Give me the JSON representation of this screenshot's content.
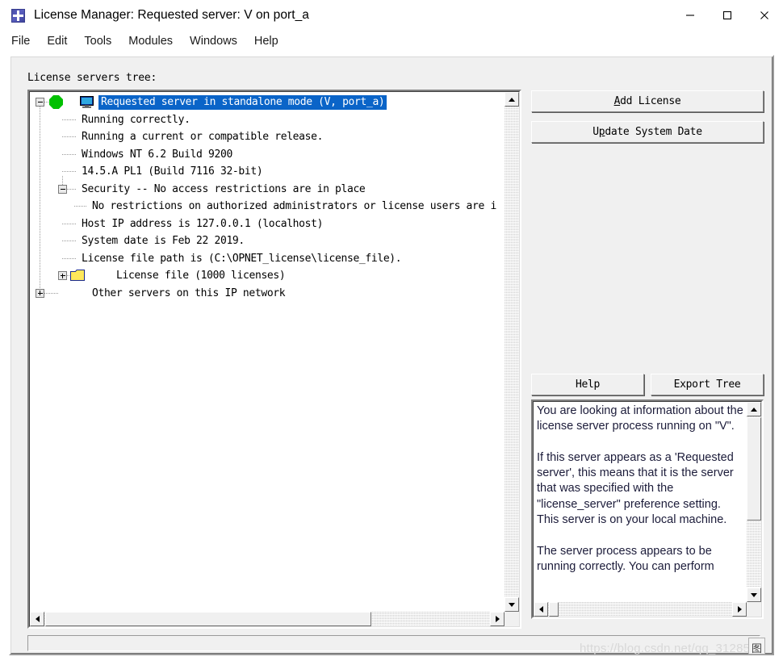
{
  "window": {
    "title": "License Manager: Requested server: V on port_a",
    "icon": "app-star-icon",
    "controls": {
      "minimize": "—",
      "maximize": "□",
      "close": "✕"
    }
  },
  "menubar": {
    "items": [
      {
        "label": "File"
      },
      {
        "label": "Edit"
      },
      {
        "label": "Tools"
      },
      {
        "label": "Modules"
      },
      {
        "label": "Windows"
      },
      {
        "label": "Help"
      }
    ]
  },
  "tree": {
    "caption": "License servers tree:",
    "rows": [
      {
        "text": "Requested server in standalone mode (V, port_a)",
        "selected": true,
        "icon": "monitor-icon",
        "status": "green-octagon-status-icon",
        "expander": "minus",
        "depth": 0
      },
      {
        "text": "Running correctly.",
        "selected": false,
        "depth": 1
      },
      {
        "text": "Running a current or compatible release.",
        "selected": false,
        "depth": 1
      },
      {
        "text": "Windows NT 6.2 Build 9200",
        "selected": false,
        "depth": 1
      },
      {
        "text": "14.5.A PL1 (Build 7116 32-bit)",
        "selected": false,
        "depth": 1
      },
      {
        "text": "Security -- No access restrictions are in place",
        "selected": false,
        "expander": "minus",
        "depth": 1
      },
      {
        "text": "No restrictions on authorized administrators or license users are i",
        "selected": false,
        "depth": 2
      },
      {
        "text": "Host IP address is 127.0.0.1 (localhost)",
        "selected": false,
        "depth": 1
      },
      {
        "text": "System date is Feb 22 2019.",
        "selected": false,
        "depth": 1
      },
      {
        "text": "License file path is (C:\\OPNET_license\\license_file).",
        "selected": false,
        "depth": 1
      },
      {
        "text": "License file (1000 licenses)",
        "selected": false,
        "expander": "plus",
        "icon": "folder-icon",
        "depth": 1
      },
      {
        "text": "Other servers on this IP network",
        "selected": false,
        "expander": "plus",
        "depth": 0
      }
    ]
  },
  "buttons": {
    "add_license": {
      "pre": "",
      "accel": "A",
      "post": "dd License"
    },
    "update_system_date": {
      "pre": "U",
      "accel": "p",
      "post": "date System Date"
    },
    "help": "Help",
    "export_tree": "Export Tree"
  },
  "help_panel": {
    "text": "You are looking at information about the license server process running on \"V\".\n\nIf this server appears as a 'Requested server', this means that it is the server that was specified with the \"license_server\" preference setting.\nThis server is on your local machine.\n\nThe server process appears to be running correctly. You can perform"
  },
  "watermark": {
    "text": "https://blog.csdn.net/qq_31285",
    "badge": "图"
  },
  "colors": {
    "selection": "#0a64c8",
    "status_ok": "#00c000",
    "folder": "#ffe85a",
    "face": "#f0f0f0"
  }
}
